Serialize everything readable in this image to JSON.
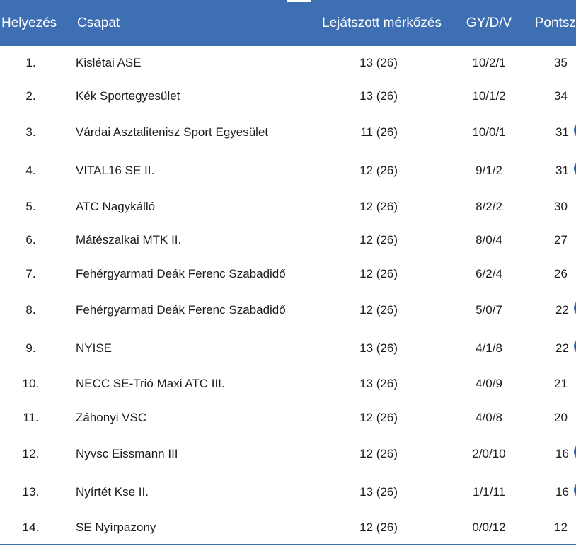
{
  "table": {
    "headers": {
      "rank": "Helyezés",
      "team": "Csapat",
      "played": "Lejátszott mérkőzés",
      "wdl": "GY/D/V",
      "points": "Pontszám"
    },
    "rows": [
      {
        "rank": "1.",
        "team": "Kislétai ASE",
        "played": "13 (26)",
        "wdl": "10/2/1",
        "points": "35",
        "has_info": false
      },
      {
        "rank": "2.",
        "team": "Kék Sportegyesület",
        "played": "13 (26)",
        "wdl": "10/1/2",
        "points": "34",
        "has_info": false
      },
      {
        "rank": "3.",
        "team": "Várdai Asztalitenisz Sport Egyesület",
        "played": "11 (26)",
        "wdl": "10/0/1",
        "points": "31",
        "has_info": true
      },
      {
        "rank": "4.",
        "team": "VITAL16 SE II.",
        "played": "12 (26)",
        "wdl": "9/1/2",
        "points": "31",
        "has_info": true
      },
      {
        "rank": "5.",
        "team": "ATC Nagykálló",
        "played": "12 (26)",
        "wdl": "8/2/2",
        "points": "30",
        "has_info": false
      },
      {
        "rank": "6.",
        "team": "Mátészalkai MTK II.",
        "played": "12 (26)",
        "wdl": "8/0/4",
        "points": "27",
        "has_info": false
      },
      {
        "rank": "7.",
        "team": "Fehérgyarmati Deák Ferenc Szabadidő",
        "played": "12 (26)",
        "wdl": "6/2/4",
        "points": "26",
        "has_info": false
      },
      {
        "rank": "8.",
        "team": "Fehérgyarmati Deák Ferenc Szabadidő",
        "played": "12 (26)",
        "wdl": "5/0/7",
        "points": "22",
        "has_info": true
      },
      {
        "rank": "9.",
        "team": "NYISE",
        "played": "13 (26)",
        "wdl": "4/1/8",
        "points": "22",
        "has_info": true
      },
      {
        "rank": "10.",
        "team": "NECC SE-Trió Maxi ATC III.",
        "played": "13 (26)",
        "wdl": "4/0/9",
        "points": "21",
        "has_info": false
      },
      {
        "rank": "11.",
        "team": "Záhonyi VSC",
        "played": "12 (26)",
        "wdl": "4/0/8",
        "points": "20",
        "has_info": false
      },
      {
        "rank": "12.",
        "team": "Nyvsc Eissmann III",
        "played": "12 (26)",
        "wdl": "2/0/10",
        "points": "16",
        "has_info": true
      },
      {
        "rank": "13.",
        "team": "Nyírtét Kse II.",
        "played": "13 (26)",
        "wdl": "1/1/11",
        "points": "16",
        "has_info": true
      },
      {
        "rank": "14.",
        "team": "SE Nyírpazony",
        "played": "12 (26)",
        "wdl": "0/0/12",
        "points": "12",
        "has_info": false
      }
    ]
  },
  "colors": {
    "header_bg": "#3f6fb3",
    "info_icon_red": "#d21414",
    "info_icon_blue": "#3b6fb8"
  },
  "icons": {
    "info": "info-magnifier-icon"
  }
}
